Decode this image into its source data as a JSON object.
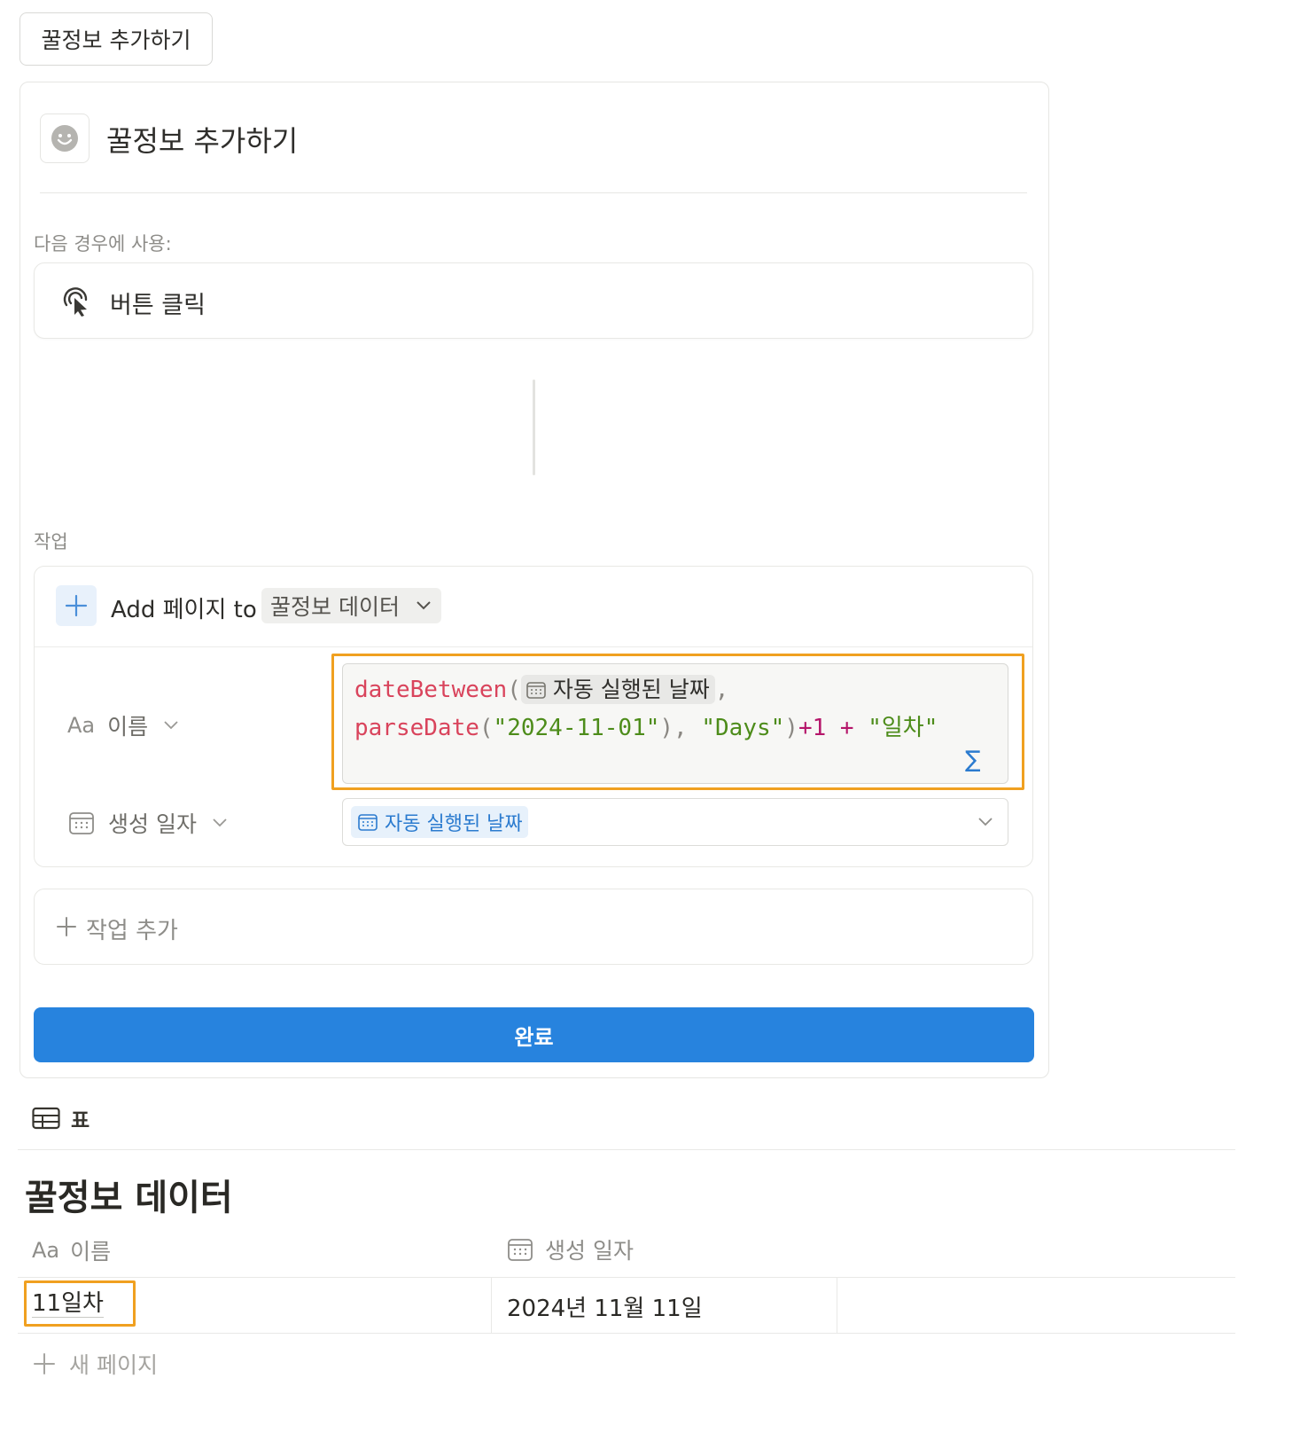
{
  "button_block": {
    "label": "꿀정보 추가하기"
  },
  "editor": {
    "title": "꿀정보 추가하기",
    "trigger_section_label": "다음 경우에 사용:",
    "trigger_label": "버튼 클릭",
    "actions_section_label": "작업",
    "action": {
      "prefix": "Add 페이지 to",
      "database": "꿀정보 데이터",
      "properties": [
        {
          "icon": "Aa",
          "name": "이름"
        },
        {
          "name": "생성 일자"
        }
      ]
    },
    "formula": {
      "fn1": "dateBetween",
      "mention": "자동 실행된 날짜",
      "fn2": "parseDate",
      "date_str": "\"2024-11-01\"",
      "days_str": "\"Days\"",
      "plus_one": "+1",
      "plus": "+",
      "suffix_str": "\"일차\"",
      "sigma": "∑"
    },
    "date_value": "자동 실행된 날짜",
    "add_action_label": "작업 추가",
    "done_label": "완료"
  },
  "view": {
    "icon_label": "표"
  },
  "database": {
    "title": "꿀정보 데이터",
    "columns": [
      {
        "icon": "Aa",
        "name": "이름"
      },
      {
        "name": "생성 일자"
      }
    ],
    "rows": [
      {
        "name": "11일차",
        "created": "2024년 11월 11일"
      }
    ],
    "new_page_label": "새 페이지"
  },
  "colors": {
    "accent": "#2783de",
    "highlight": "#f0a020"
  }
}
